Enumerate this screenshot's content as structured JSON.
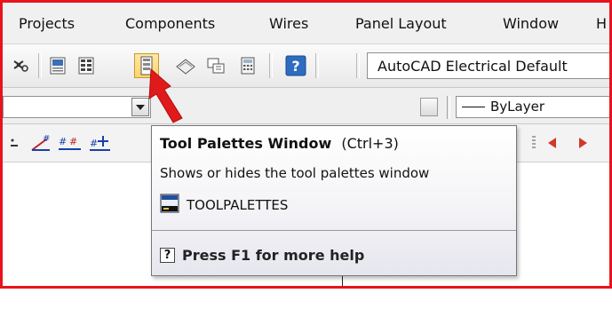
{
  "menubar": {
    "items": [
      "Projects",
      "Components",
      "Wires",
      "Panel Layout",
      "Window",
      "H"
    ]
  },
  "toolbar": {
    "text_style": "AutoCAD Electrical Default",
    "linetype": "ByLayer",
    "layer_partial": "ByLayer"
  },
  "tooltip": {
    "title": "Tool Palettes Window",
    "shortcut": "(Ctrl+3)",
    "description": "Shows or hides the tool palettes window",
    "command": "TOOLPALETTES",
    "help_glyph": "?",
    "help": "Press F1 for more help"
  },
  "colors": {
    "frame_border": "#e8131b",
    "arrow": "#e01a1a",
    "toolbar_red_triangle": "#d0382a"
  },
  "icons": [
    "zoom-icon",
    "properties-icon",
    "design-center-icon",
    "tool-palettes-icon",
    "sheet-set-icon",
    "markup-icon",
    "calculator-icon",
    "help-icon",
    "wire-number-icon",
    "wire-numbers-icon",
    "scoot-icon",
    "triangle-left-icon",
    "triangle-right-icon"
  ]
}
